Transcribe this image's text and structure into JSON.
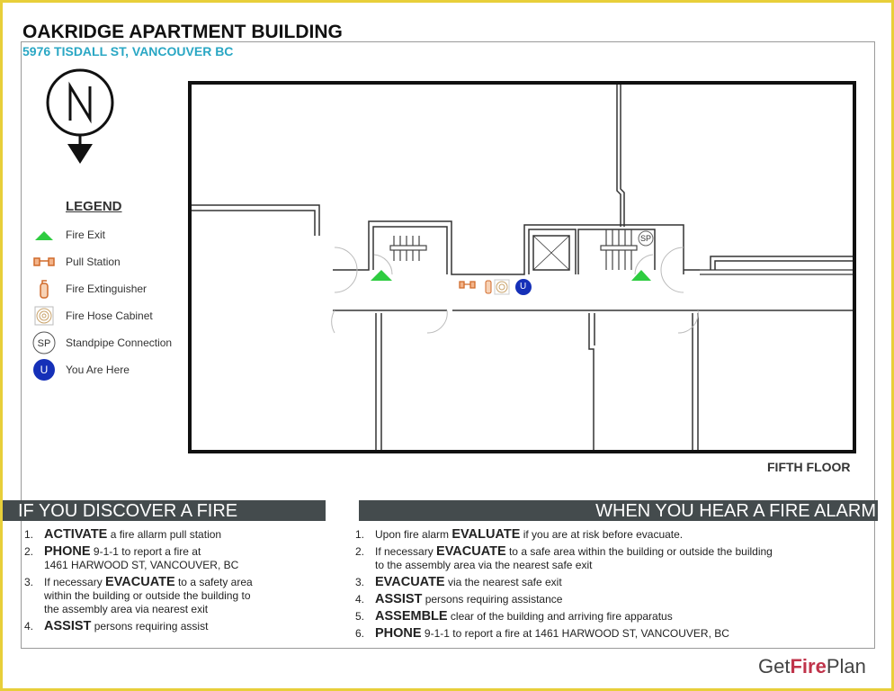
{
  "header": {
    "title": "OAKRIDGE APARTMENT BUILDING",
    "address": "5976 TISDALL ST, VANCOUVER BC"
  },
  "compass": {
    "icon": "north-arrow-icon"
  },
  "legend": {
    "title": "LEGEND",
    "items": [
      {
        "label": "Fire Exit",
        "icon": "fire-exit-icon",
        "color": "#2ecc40"
      },
      {
        "label": "Pull Station",
        "icon": "pull-station-icon",
        "color": "#e07b39"
      },
      {
        "label": "Fire Extinguisher",
        "icon": "fire-extinguisher-icon",
        "color": "#e07b39"
      },
      {
        "label": "Fire Hose Cabinet",
        "icon": "fire-hose-icon",
        "color": "#c9a36b"
      },
      {
        "label": "Standpipe Connection",
        "icon": "standpipe-icon",
        "text": "SP"
      },
      {
        "label": "You Are Here",
        "icon": "you-are-here-icon",
        "text": "U",
        "color": "#1530b8"
      }
    ]
  },
  "plan": {
    "floor_label": "FIFTH FLOOR",
    "sp_label": "SP",
    "you_label": "U"
  },
  "discover": {
    "title": "IF YOU DISCOVER A FIRE",
    "items": [
      {
        "n": "1.",
        "bold": "ACTIVATE",
        "text": " a fire allarm pull station"
      },
      {
        "n": "2.",
        "bold": "PHONE",
        "text": " 9-1-1 to report a fire at",
        "line2": "1461 HARWOOD ST, VANCOUVER, BC"
      },
      {
        "n": "3.",
        "pre": "If necessary ",
        "bold": "EVACUATE",
        "text": " to a safety area",
        "line2": "within the building or outside the building to",
        "line3": "the assembly area via nearest exit"
      },
      {
        "n": "4.",
        "bold": "ASSIST",
        "text": " persons requiring assist"
      }
    ]
  },
  "alarm": {
    "title": "WHEN YOU HEAR A FIRE ALARM",
    "items": [
      {
        "n": "1.",
        "pre": "Upon fire alarm ",
        "bold": "EVALUATE",
        "text": " if you are at risk before evacuate."
      },
      {
        "n": "2.",
        "pre": "If necessary ",
        "bold": "EVACUATE",
        "text": " to a safe area within the building or outside the building",
        "line2": "to the assembly area via the nearest safe exit"
      },
      {
        "n": "3.",
        "bold": "EVACUATE",
        "text": "  via the nearest safe exit"
      },
      {
        "n": "4.",
        "bold": "ASSIST",
        "text": " persons requiring assistance"
      },
      {
        "n": "5.",
        "bold": "ASSEMBLE",
        "text": " clear of the building and arriving fire apparatus"
      },
      {
        "n": "6.",
        "bold": "PHONE",
        "text": " 9-1-1 to report a fire at 1461 HARWOOD ST, VANCOUVER, BC"
      }
    ]
  },
  "logo": {
    "get": "Get",
    "fire": "Fire",
    "plan": "Plan"
  }
}
